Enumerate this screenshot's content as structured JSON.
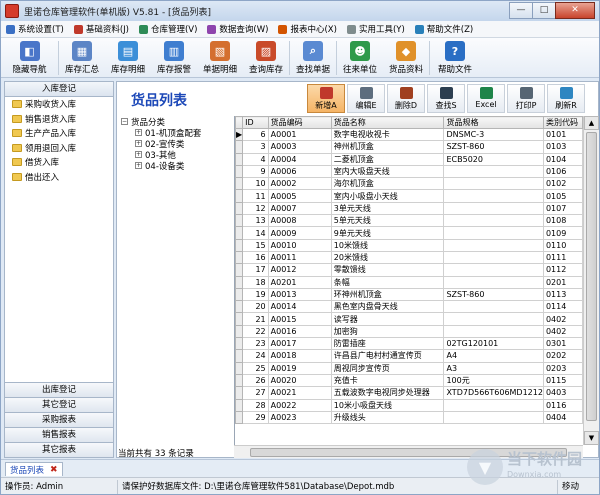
{
  "window": {
    "title": "里诺仓库管理软件(单机版) V5.81 - [货品列表]",
    "min": "—",
    "max": "□",
    "close": "✕"
  },
  "menus": [
    {
      "label": "系统设置(T)",
      "icon": "settings-icon",
      "color": "#3a6fc4"
    },
    {
      "label": "基础资料(J)",
      "icon": "data-icon",
      "color": "#c0392b"
    },
    {
      "label": "仓库管理(V)",
      "icon": "warehouse-icon",
      "color": "#2e8b57"
    },
    {
      "label": "数据查询(W)",
      "icon": "query-icon",
      "color": "#8e44ad"
    },
    {
      "label": "报表中心(X)",
      "icon": "report-icon",
      "color": "#d35400"
    },
    {
      "label": "实用工具(Y)",
      "icon": "tools-icon",
      "color": "#7f8c8d"
    },
    {
      "label": "帮助文件(Z)",
      "icon": "help-icon",
      "color": "#2980b9"
    }
  ],
  "toolbar": [
    {
      "label": "隐藏导航",
      "icon": "nav-hide-icon",
      "color": "#4a76c9",
      "glyph": "◧",
      "w": 57
    },
    {
      "label": "库存汇总",
      "icon": "summary-icon",
      "color": "#5c85c6",
      "glyph": "▦",
      "w": 46
    },
    {
      "label": "库存明细",
      "icon": "detail-icon",
      "color": "#3c8fd8",
      "glyph": "▤",
      "w": 46
    },
    {
      "label": "库存报警",
      "icon": "alarm-icon",
      "color": "#3f7ed0",
      "glyph": "▥",
      "w": 46
    },
    {
      "label": "单据明细",
      "icon": "bill-icon",
      "color": "#d46f2f",
      "glyph": "▧",
      "w": 46
    },
    {
      "label": "查询库存",
      "icon": "stock-query-icon",
      "color": "#c94b2a",
      "glyph": "▨",
      "w": 46
    },
    {
      "label": "查找单据",
      "icon": "find-bill-icon",
      "color": "#5a8ad2",
      "glyph": "⌕",
      "w": 46
    },
    {
      "label": "往来单位",
      "icon": "partner-icon",
      "color": "#2e9a4a",
      "glyph": "☻",
      "w": 46
    },
    {
      "label": "货品资料",
      "icon": "goods-icon",
      "color": "#e0912a",
      "glyph": "◆",
      "w": 46
    },
    {
      "label": "帮助文件",
      "icon": "help-file-icon",
      "color": "#2a6ec4",
      "glyph": "?",
      "w": 50
    }
  ],
  "nav": {
    "header": "入库登记",
    "items": [
      "采购收货入库",
      "销售退货入库",
      "生产产品入库",
      "领用退回入库",
      "借货入库",
      "借出还入"
    ],
    "bottom": [
      "出库登记",
      "其它登记",
      "采购报表",
      "销售报表",
      "其它报表"
    ]
  },
  "page": {
    "title": "货品列表",
    "actions": [
      {
        "label": "新增A",
        "icon": "add-icon",
        "color": "#c0392b",
        "hl": true
      },
      {
        "label": "编辑E",
        "icon": "edit-icon",
        "color": "#5d6d7e",
        "hl": false
      },
      {
        "label": "删除D",
        "icon": "delete-icon",
        "color": "#a04020",
        "hl": false
      },
      {
        "label": "查找S",
        "icon": "find-icon",
        "color": "#2c3e50",
        "hl": false
      },
      {
        "label": "Excel",
        "icon": "excel-icon",
        "color": "#1e8449",
        "hl": false
      },
      {
        "label": "打印P",
        "icon": "print-icon",
        "color": "#566573",
        "hl": false
      },
      {
        "label": "刷新R",
        "icon": "refresh-icon",
        "color": "#2e86c1",
        "hl": false
      }
    ],
    "tree": {
      "root": "货品分类",
      "children": [
        "01-机顶盒配套",
        "02-宣传类",
        "03-其他",
        "04-设备类"
      ]
    },
    "columns": [
      "ID",
      "货品编码",
      "货品名称",
      "货品规格",
      "类別代码"
    ],
    "rows": [
      [
        "6",
        "A0001",
        "数字电视收视卡",
        "DNSMC-3",
        "0101"
      ],
      [
        "3",
        "A0003",
        "神州机顶盒",
        "SZST-860",
        "0103"
      ],
      [
        "4",
        "A0004",
        "二菱机顶盒",
        "ECB5020",
        "0104"
      ],
      [
        "9",
        "A0006",
        "室内大吸盘天线",
        "",
        "0106"
      ],
      [
        "10",
        "A0002",
        "海尔机顶盒",
        "",
        "0102"
      ],
      [
        "11",
        "A0005",
        "室内小吸盘小天线",
        "",
        "0105"
      ],
      [
        "12",
        "A0007",
        "3单元天线",
        "",
        "0107"
      ],
      [
        "13",
        "A0008",
        "5单元天线",
        "",
        "0108"
      ],
      [
        "14",
        "A0009",
        "9单元天线",
        "",
        "0109"
      ],
      [
        "15",
        "A0010",
        "10米馈线",
        "",
        "0110"
      ],
      [
        "16",
        "A0011",
        "20米馈线",
        "",
        "0111"
      ],
      [
        "17",
        "A0012",
        "零散馈线",
        "",
        "0112"
      ],
      [
        "18",
        "A0201",
        "条幅",
        "",
        "0201"
      ],
      [
        "19",
        "A0013",
        "环神州机顶盒",
        "SZST-860",
        "0113"
      ],
      [
        "20",
        "A0014",
        "黑色室内盘骨天线",
        "",
        "0114"
      ],
      [
        "21",
        "A0015",
        "读写器",
        "",
        "0402"
      ],
      [
        "22",
        "A0016",
        "加密狗",
        "",
        "0402"
      ],
      [
        "23",
        "A0017",
        "防雷插座",
        "02TG120101",
        "0301"
      ],
      [
        "24",
        "A0018",
        "许昌县广电村村通宣传页",
        "A4",
        "0202"
      ],
      [
        "25",
        "A0019",
        "周视同步宣传页",
        "A3",
        "0203"
      ],
      [
        "26",
        "A0020",
        "充值卡",
        "100元",
        "0115"
      ],
      [
        "27",
        "A0021",
        "五载波数字电视同步处理器",
        "XTD7D566T606MD1212",
        "0403"
      ],
      [
        "28",
        "A0022",
        "10米小吸盘天线",
        "",
        "0116"
      ],
      [
        "29",
        "A0023",
        "升级线头",
        "",
        "0404"
      ]
    ],
    "footer": "当前共有 33 条记录"
  },
  "tab": {
    "label": "货品列表",
    "close": "✖"
  },
  "status": {
    "operator": "操作员: Admin",
    "dbfile": "请保护好数据库文件: D:\\里诺仓库管理软件581\\Database\\Depot.mdb",
    "mode": "移动"
  },
  "watermark": {
    "text": "当下软件园",
    "sub": "Downxia.com",
    "glyph": "▼"
  }
}
